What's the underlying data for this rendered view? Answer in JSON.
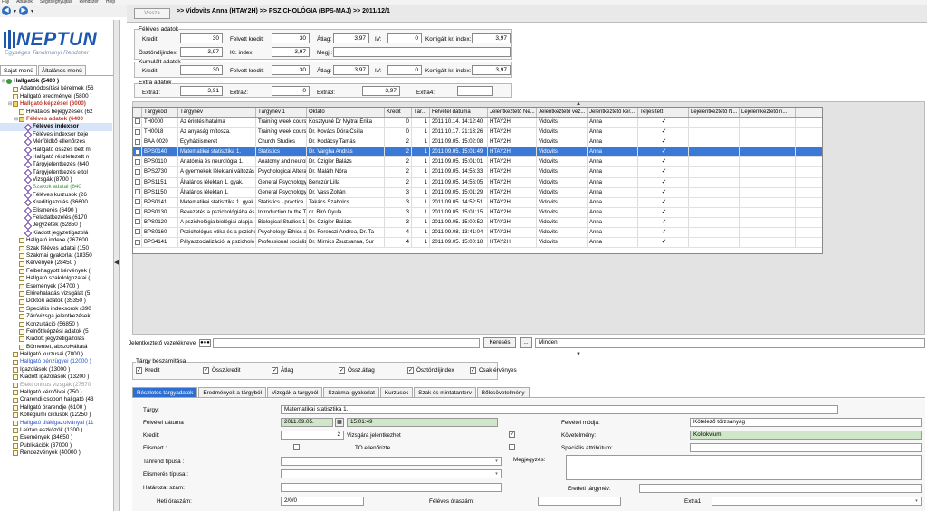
{
  "menubar": [
    "Fájl",
    "Ablakok",
    "Segítségnyújtás",
    "Rendszer",
    "Help"
  ],
  "header": {
    "back_label": "Vissza",
    "breadcrumb": ">> Vidovits Anna (HTAY2H) >> PSZICHOLÓGIA (BPS-MAJ) >> 2011/12/1"
  },
  "logo": {
    "text": "NEPTUN",
    "subtitle": "Egységes Tanulmányi Rendszer"
  },
  "side_tabs": [
    "Saját menü",
    "Általános menü"
  ],
  "tree": [
    {
      "label": "Hallgatók (5400 )",
      "indent": 0,
      "icon": "user-icon",
      "bold": true
    },
    {
      "label": "Adatmódosítási kérelmek (56",
      "indent": 1,
      "icon": "doc"
    },
    {
      "label": "Hallgató eredményei (5800 )",
      "indent": 1,
      "icon": "doc"
    },
    {
      "label": "Hallgató képzései (6000)",
      "indent": 1,
      "icon": "folder",
      "bold": true,
      "color": "#c0392b"
    },
    {
      "label": "Hivatalos bejegyzések (62",
      "indent": 2,
      "icon": "doc"
    },
    {
      "label": "Féléves adatok (6400",
      "indent": 2,
      "icon": "folder",
      "bold": true,
      "color": "#c0392b"
    },
    {
      "label": "Féléves indexsor",
      "indent": 3,
      "icon": "dia",
      "bold": true,
      "highlight": true
    },
    {
      "label": "Féléves indexsor beje",
      "indent": 3,
      "icon": "dia"
    },
    {
      "label": "Mérföldkő ellenőrzés",
      "indent": 3,
      "icon": "dia"
    },
    {
      "label": "Hallgató összes bett m",
      "indent": 3,
      "icon": "dia"
    },
    {
      "label": "Hallgató részletezett n",
      "indent": 3,
      "icon": "dia"
    },
    {
      "label": "Tárgyjelentkezés (640",
      "indent": 3,
      "icon": "dia"
    },
    {
      "label": "Tárgyjelentkezés eltol",
      "indent": 3,
      "icon": "dia"
    },
    {
      "label": "Vizsgák (8700 )",
      "indent": 3,
      "icon": "dia"
    },
    {
      "label": "Szakok adatai (640",
      "indent": 3,
      "icon": "dia",
      "color": "#3c9a3c"
    },
    {
      "label": "Féléves kurzusok (26",
      "indent": 3,
      "icon": "dia"
    },
    {
      "label": "Kreditigazolás (36600",
      "indent": 3,
      "icon": "dia"
    },
    {
      "label": "Elismerés (6490 )",
      "indent": 3,
      "icon": "dia"
    },
    {
      "label": "Feladatkezelés (6170",
      "indent": 3,
      "icon": "dia"
    },
    {
      "label": "Jegyzetek (62850 )",
      "indent": 3,
      "icon": "dia"
    },
    {
      "label": "Kiadott jegyzetigazolá",
      "indent": 3,
      "icon": "dia"
    },
    {
      "label": "Hallgató indexe (267600",
      "indent": 2,
      "icon": "doc"
    },
    {
      "label": "Szak féléves adatai (150",
      "indent": 2,
      "icon": "doc"
    },
    {
      "label": "Szakmai gyakorlat (18350",
      "indent": 2,
      "icon": "doc"
    },
    {
      "label": "Kérvények (28450 )",
      "indent": 2,
      "icon": "doc"
    },
    {
      "label": "Felbehagyott kérvények (",
      "indent": 2,
      "icon": "doc"
    },
    {
      "label": "Hallgató szakdolgozatai (",
      "indent": 2,
      "icon": "doc"
    },
    {
      "label": "Események (34700 )",
      "indent": 2,
      "icon": "doc"
    },
    {
      "label": "Előrehaladás vizsgálat (5",
      "indent": 2,
      "icon": "doc"
    },
    {
      "label": "Doktori adatok (35350 )",
      "indent": 2,
      "icon": "doc"
    },
    {
      "label": "Speciális indexsorok (390",
      "indent": 2,
      "icon": "doc"
    },
    {
      "label": "Záróvizsga jelentkezések",
      "indent": 2,
      "icon": "doc"
    },
    {
      "label": "Konzultáció (56850 )",
      "indent": 2,
      "icon": "doc"
    },
    {
      "label": "Felnőttképzési adatok (5",
      "indent": 2,
      "icon": "doc"
    },
    {
      "label": "Kiadott jegyzetigazolás",
      "indent": 2,
      "icon": "doc"
    },
    {
      "label": "Bőrnentet, abszolváltatá",
      "indent": 2,
      "icon": "doc"
    },
    {
      "label": "Hallgató kurzusai (7800 )",
      "indent": 1,
      "icon": "doc"
    },
    {
      "label": "Hallgató pénzügyei (12000 )",
      "indent": 1,
      "icon": "doc",
      "color": "#2b55c4"
    },
    {
      "label": "Igazolások (13000 )",
      "indent": 1,
      "icon": "doc"
    },
    {
      "label": "Kiadott igazolások (13200 )",
      "indent": 1,
      "icon": "doc"
    },
    {
      "label": "Elektronikus vizsgák (27570",
      "indent": 1,
      "icon": "doc",
      "color": "#999"
    },
    {
      "label": "Hallgató kérdőívei (750 )",
      "indent": 1,
      "icon": "doc"
    },
    {
      "label": "Órarendi csoport hallgató (43",
      "indent": 1,
      "icon": "doc"
    },
    {
      "label": "Hallgató órarendje (6100 )",
      "indent": 1,
      "icon": "doc"
    },
    {
      "label": "Kollégiumi ciklusok (12250 )",
      "indent": 1,
      "icon": "doc"
    },
    {
      "label": "Hallgató diákigazolványai (11",
      "indent": 1,
      "icon": "doc",
      "color": "#2b55c4"
    },
    {
      "label": "Leírtán eszközök (1300 )",
      "indent": 1,
      "icon": "doc"
    },
    {
      "label": "Események (34650 )",
      "indent": 1,
      "icon": "doc"
    },
    {
      "label": "Publikációk (37000 )",
      "indent": 1,
      "icon": "doc"
    },
    {
      "label": "Rendezvények (40000 )",
      "indent": 1,
      "icon": "doc"
    }
  ],
  "feleves": {
    "legend": "Féléves adatok",
    "kredit_label": "Kredit:",
    "kredit": "30",
    "felvett_kredit_label": "Felvett kredit:",
    "felvett_kredit": "30",
    "atlag_label": "Átlag:",
    "atlag": "3,97",
    "iv_label": "IV:",
    "iv": "0",
    "korrigalt_label": "Korrigált kr. index:",
    "korrigalt": "3,97",
    "osztondij_label": "Ösztöndíjindex:",
    "osztondij": "3,97",
    "kr_index_label": "Kr. index:",
    "kr_index": "3,97",
    "megj_label": "Megj.:",
    "megj": ""
  },
  "kumulalt": {
    "legend": "Kumulált adatok",
    "kredit_label": "Kredit:",
    "kredit": "30",
    "felvett_kredit_label": "Felvett kredit:",
    "felvett_kredit": "30",
    "atlag_label": "Átlag:",
    "atlag": "3,97",
    "iv_label": "IV:",
    "iv": "0",
    "korrigalt_label": "Korrigált kr. index:",
    "korrigalt": "3,97"
  },
  "extra": {
    "legend": "Extra adatok",
    "extra1_label": "Extra1:",
    "extra1": "3,91",
    "extra2_label": "Extra2:",
    "extra2": "0",
    "extra3_label": "Extra3:",
    "extra3": "3,97",
    "extra4_label": "Extra4:",
    "extra4": ""
  },
  "grid": {
    "headers": [
      "",
      "Tárgykód",
      "Tárgynév",
      "Tárgynév 1",
      "Oktató",
      "Kredit",
      "Tár...",
      "Felvétel dátuma",
      "Jelentkeztető Ne...",
      "Jelentkeztető vez...",
      "Jelentkeztető ker...",
      "Teljesített",
      "Lejelentkeztető N...",
      "Lejelentkeztető n..."
    ],
    "rows": [
      [
        "",
        "TH0000",
        "Az érintés hatalma",
        "Training week cours",
        "Kosztyuné Dr Nyitrai Erika",
        "0",
        "1",
        "2011.10.14. 14:12:40",
        "HTAY2H",
        "Vidovits",
        "Anna",
        "✓",
        "",
        ""
      ],
      [
        "",
        "TH0018",
        "Az anyaság mítosza.",
        "Training week cours",
        "Dr. Kovács Dóra Csilla",
        "0",
        "1",
        "2011.10.17. 21:13:26",
        "HTAY2H",
        "Vidovits",
        "Anna",
        "✓",
        "",
        ""
      ],
      [
        "",
        "BAA 0020",
        "Egyháziismeret",
        "Church Studies",
        "Dr. Kodácsy Tamás",
        "2",
        "1",
        "2011.09.05. 15:02:08",
        "HTAY2H",
        "Vidovits",
        "Anna",
        "✓",
        "",
        ""
      ],
      [
        "",
        "BPS0140",
        "Matematikai statisztika 1.",
        "Statistics",
        "Dr. Vargha András",
        "2",
        "1",
        "2011.09.05. 15:01:49",
        "HTAY2H",
        "Vidovits",
        "Anna",
        "✓",
        "",
        ""
      ],
      [
        "",
        "BPS0110",
        "Anatómia és neurológia 1.",
        "Anatomy and neurol",
        "Dr. Czigler Balázs",
        "2",
        "1",
        "2011.09.05. 15:01:01",
        "HTAY2H",
        "Vidovits",
        "Anna",
        "✓",
        "",
        ""
      ],
      [
        "",
        "BPS2730",
        "A gyermekek lélektani változás",
        "Psychological Altera",
        "Dr. Maláth Nóra",
        "2",
        "1",
        "2011.09.05. 14:56:33",
        "HTAY2H",
        "Vidovits",
        "Anna",
        "✓",
        "",
        ""
      ],
      [
        "",
        "BPS1151",
        "Általános lélektan 1. gyak.",
        "General Psychology",
        "Benczúr Lilla",
        "2",
        "1",
        "2011.09.05. 14:56:05",
        "HTAY2H",
        "Vidovits",
        "Anna",
        "✓",
        "",
        ""
      ],
      [
        "",
        "BPS1150",
        "Általános lélektan 1.",
        "General Psychology",
        "Dr. Vass Zoltán",
        "3",
        "1",
        "2011.09.05. 15:01:29",
        "HTAY2H",
        "Vidovits",
        "Anna",
        "✓",
        "",
        ""
      ],
      [
        "",
        "BPS0141",
        "Matematikai statisztika 1. gyak.",
        "Statistics - practice",
        "Takács Szabolcs",
        "3",
        "1",
        "2011.09.05. 14:52:51",
        "HTAY2H",
        "Vidovits",
        "Anna",
        "✓",
        "",
        ""
      ],
      [
        "",
        "BPS0130",
        "Bevezetés a pszichológiába és",
        "Introduction to the T",
        "dr. Biró Gyula",
        "3",
        "1",
        "2011.09.05. 15:01:15",
        "HTAY2H",
        "Vidovits",
        "Anna",
        "✓",
        "",
        ""
      ],
      [
        "",
        "BPS0120",
        "A pszichológia biológiai alapjai",
        "Biological Studies 1.",
        "Dr. Czigler Balázs",
        "3",
        "1",
        "2011.09.05. 15:00:52",
        "HTAY2H",
        "Vidovits",
        "Anna",
        "✓",
        "",
        ""
      ],
      [
        "",
        "BPS0160",
        "Pszichológus etika és a pszicho",
        "Psychology Ethics a",
        "Dr. Ferenczi Andrea, Dr. Ta",
        "4",
        "1",
        "2011.09.08. 13:41:04",
        "HTAY2H",
        "Vidovits",
        "Anna",
        "✓",
        "",
        ""
      ],
      [
        "",
        "BPS4141",
        "Pályaszocializáció: a pszicholó",
        "Professional socializ",
        "Dr. Mirnics Zsuzsanna, Sur",
        "4",
        "1",
        "2011.09.05. 15:00:18",
        "HTAY2H",
        "Vidovits",
        "Anna",
        "✓",
        "",
        ""
      ]
    ],
    "selected_row": 3
  },
  "filter": {
    "label": "Jelentkeztető vezetékneve",
    "value": "",
    "search_button": "Keresés",
    "dots_button": "...",
    "result_label": "Minden"
  },
  "beszamitas": {
    "legend": "Tárgy beszámítása",
    "items": [
      {
        "label": "Kredit",
        "checked": true
      },
      {
        "label": "Össz.kredit",
        "checked": true
      },
      {
        "label": "Átlag",
        "checked": true
      },
      {
        "label": "Össz.átlag",
        "checked": true
      },
      {
        "label": "Ösztöndíjindex",
        "checked": true
      }
    ],
    "csak_ervenyes_label": "Csak érvényes",
    "csak_ervenyes": true
  },
  "tabs": [
    "Részletes tárgyadatok",
    "Eredmények a tárgyból",
    "Vizsgák a tárgyból",
    "Szakmai gyakorlat",
    "Kurzusok",
    "Szak és mintatanterv",
    "Bőlcsövetelmény"
  ],
  "details": {
    "targy_label": "Tárgy:",
    "targy": "Matematikai statisztika 1.",
    "felvetel_datuma_label": "Felvétel dátuma",
    "felvetel_datum": "2011.09.05.",
    "felvetel_ido": "15:01:49",
    "kredit_label": "Kredit:",
    "kredit": "2",
    "vizsgara_label": "Vizsgára jelentkezhet",
    "vizsgara": true,
    "elismert_label": "Elismert :",
    "to_ellenorizte_label": "TO ellenőrizte",
    "tanrend_label": "Tanrend típusa :",
    "tanrend": "",
    "elismeres_label": "Elismerés típusa :",
    "elismeres": "",
    "hatarozat_label": "Határozat szám:",
    "hatarozat": "",
    "heti_oraszam_label": "Heti óraszám:",
    "heti_oraszam": "2/0/0",
    "feleves_oraszam_label": "Féléves óraszám:",
    "feleves_oraszam": "",
    "extra1_label": "Extra1",
    "extra1": "",
    "felvetel_modja_label": "Felvétel módja:",
    "felvetel_modja": "Kötelező törzsanyag",
    "kovetelmeny_label": "Követelmény:",
    "kovetelmeny": "Kollokvium",
    "specialis_label": "Speciális attribútum:",
    "specialis": "",
    "megjegyzes_label": "Megjegyzés:",
    "megjegyzes": "",
    "eredeti_targynev_label": "Eredeti tárgynév:",
    "eredeti_targynev": ""
  }
}
